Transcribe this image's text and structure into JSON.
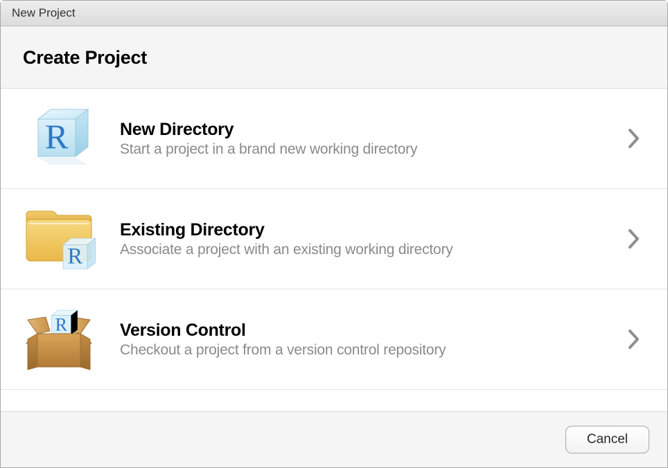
{
  "window": {
    "title": "New Project"
  },
  "header": {
    "title": "Create Project"
  },
  "options": [
    {
      "key": "new-directory",
      "title": "New Directory",
      "description": "Start a project in a brand new working directory"
    },
    {
      "key": "existing-directory",
      "title": "Existing Directory",
      "description": "Associate a project with an existing working directory"
    },
    {
      "key": "version-control",
      "title": "Version Control",
      "description": "Checkout a project from a version control repository"
    }
  ],
  "footer": {
    "cancel_label": "Cancel"
  }
}
